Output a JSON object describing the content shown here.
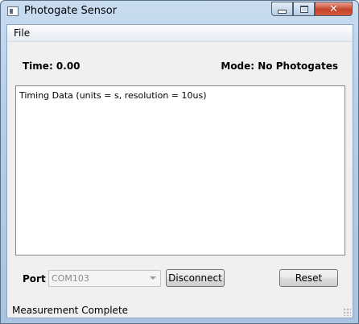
{
  "window": {
    "title": "Photogate Sensor",
    "close_glyph": "✕"
  },
  "menu": {
    "items": [
      {
        "label": "File"
      }
    ]
  },
  "header": {
    "time_text": "Time: 0.00",
    "mode_text": "Mode: No Photogates"
  },
  "output": {
    "text": "Timing Data (units = s, resolution = 10us)"
  },
  "controls": {
    "port_label": "Port",
    "port_value": "COM103",
    "port_enabled": false,
    "disconnect_label": "Disconnect",
    "reset_label": "Reset"
  },
  "status": {
    "text": "Measurement Complete"
  },
  "icons": {
    "app": "app-window-icon",
    "minimize": "minimize-icon",
    "maximize": "maximize-icon",
    "close": "close-icon",
    "dropdown": "chevron-down-icon"
  },
  "colors": {
    "title_bar": "#b7cfe8",
    "close_button": "#c7432b",
    "client_background": "#f0f0f0"
  }
}
